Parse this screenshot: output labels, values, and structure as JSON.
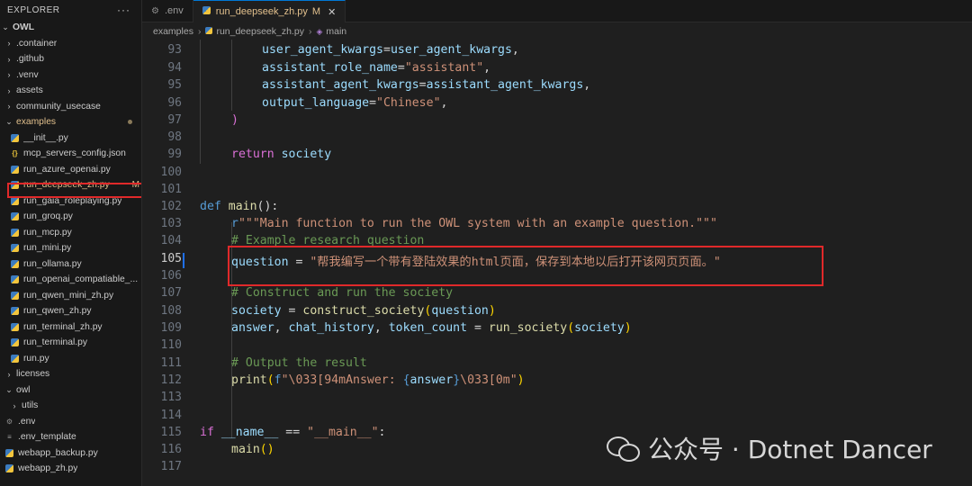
{
  "explorer": {
    "title": "EXPLORER",
    "more_icon": "ellipsis-icon",
    "root": "OWL",
    "items": [
      {
        "label": ".container",
        "type": "folder"
      },
      {
        "label": ".github",
        "type": "folder"
      },
      {
        "label": ".venv",
        "type": "folder"
      },
      {
        "label": "assets",
        "type": "folder"
      },
      {
        "label": "community_usecase",
        "type": "folder"
      },
      {
        "label": "examples",
        "type": "folder-open"
      },
      {
        "label": "__init__.py",
        "type": "py"
      },
      {
        "label": "mcp_servers_config.json",
        "type": "json"
      },
      {
        "label": "run_azure_openai.py",
        "type": "py"
      },
      {
        "label": "run_deepseek_zh.py",
        "type": "py",
        "badge": "M"
      },
      {
        "label": "run_gaia_roleplaying.py",
        "type": "py"
      },
      {
        "label": "run_groq.py",
        "type": "py"
      },
      {
        "label": "run_mcp.py",
        "type": "py"
      },
      {
        "label": "run_mini.py",
        "type": "py"
      },
      {
        "label": "run_ollama.py",
        "type": "py"
      },
      {
        "label": "run_openai_compatiable_...",
        "type": "py"
      },
      {
        "label": "run_qwen_mini_zh.py",
        "type": "py"
      },
      {
        "label": "run_qwen_zh.py",
        "type": "py"
      },
      {
        "label": "run_terminal_zh.py",
        "type": "py"
      },
      {
        "label": "run_terminal.py",
        "type": "py"
      },
      {
        "label": "run.py",
        "type": "py"
      },
      {
        "label": "licenses",
        "type": "folder"
      },
      {
        "label": "owl",
        "type": "folder-open"
      },
      {
        "label": "utils",
        "type": "folder"
      },
      {
        "label": ".env",
        "type": "gear"
      },
      {
        "label": ".env_template",
        "type": "eq"
      },
      {
        "label": "webapp_backup.py",
        "type": "py"
      },
      {
        "label": "webapp_zh.py",
        "type": "py"
      }
    ]
  },
  "tabs": [
    {
      "label": ".env",
      "icon": "gear-icon"
    },
    {
      "label": "run_deepseek_zh.py",
      "modified": "M",
      "icon": "python-icon"
    }
  ],
  "breadcrumb": {
    "folder": "examples",
    "file": "run_deepseek_zh.py",
    "symbol": "main"
  },
  "code": {
    "line_numbers": [
      "93",
      "94",
      "95",
      "96",
      "97",
      "98",
      "99",
      "100",
      "101",
      "102",
      "103",
      "104",
      "105",
      "106",
      "107",
      "108",
      "109",
      "110",
      "111",
      "112",
      "113",
      "114",
      "115",
      "116",
      "117"
    ],
    "l93": {
      "a": "user_agent_kwargs",
      "b": "=",
      "c": "user_agent_kwargs",
      "d": ","
    },
    "l94": {
      "a": "assistant_role_name",
      "b": "=",
      "c": "\"assistant\"",
      "d": ","
    },
    "l95": {
      "a": "assistant_agent_kwargs",
      "b": "=",
      "c": "assistant_agent_kwargs",
      "d": ","
    },
    "l96": {
      "a": "output_language",
      "b": "=",
      "c": "\"Chinese\"",
      "d": ","
    },
    "l97": {
      "a": ")"
    },
    "l99": {
      "a": "return",
      "b": "society"
    },
    "l102": {
      "a": "def",
      "b": "main",
      "c": "():"
    },
    "l103": {
      "a": "r",
      "b": "\"\"\"Main function to run the OWL system with an example question.\"\"\""
    },
    "l104": {
      "a": "# Example research question"
    },
    "l105": {
      "a": "question",
      "b": " = ",
      "c": "\"帮我编写一个带有登陆效果的html页面，保存到本地以后打开该网页页面。\""
    },
    "l107": {
      "a": "# Construct and run the society"
    },
    "l108": {
      "a": "society",
      "b": " = ",
      "c": "construct_society",
      "d": "(",
      "e": "question",
      "f": ")"
    },
    "l109": {
      "a": "answer",
      "b": ", ",
      "c": "chat_history",
      "d": ", ",
      "e": "token_count",
      "f": " = ",
      "g": "run_society",
      "h": "(",
      "i": "society",
      "j": ")"
    },
    "l111": {
      "a": "# Output the result"
    },
    "l112": {
      "a": "print",
      "b": "(",
      "c": "f",
      "d": "\"\\033[94mAnswer: ",
      "e": "{",
      "f": "answer",
      "g": "}",
      "h": "\\033[0m\"",
      "i": ")"
    },
    "l115": {
      "a": "if",
      "b": " __name__ ",
      "c": "==",
      "d": " \"__main__\"",
      "e": ":"
    },
    "l116": {
      "a": "main",
      "b": "()"
    }
  },
  "watermark": {
    "text": "公众号 · Dotnet Dancer",
    "icon": "wechat-icon"
  }
}
